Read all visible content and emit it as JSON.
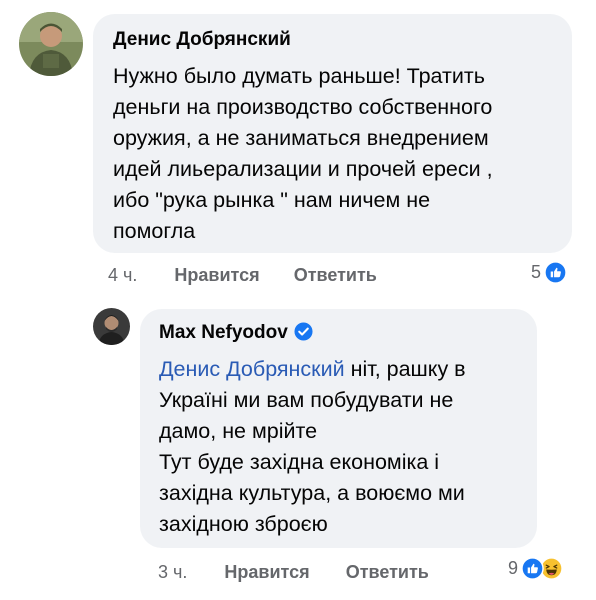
{
  "comments": [
    {
      "author": "Денис Добрянский",
      "lines": [
        "Нужно было думать раньше! Тратить",
        "деньги на производство собственного",
        "оружия,  а не заниматься внедрением",
        "идей лиьерализации и прочей ереси ,",
        "ибо \"рука рынка \" нам ничем не",
        "помогла"
      ],
      "time": "4 ч.",
      "like_label": "Нравится",
      "reply_label": "Ответить",
      "reaction_count": "5",
      "reaction_icons": [
        "like-icon"
      ]
    },
    {
      "author": "Max Nefyodov",
      "verified": true,
      "mention": "Денис Добрянский",
      "lines": [
        " ніт, рашку в",
        "Україні ми вам побудувати не",
        "дамо, не мрійте",
        "Тут буде західна економіка і",
        "західна культура, а воюємо ми",
        "західною зброєю"
      ],
      "time": "3 ч.",
      "like_label": "Нравится",
      "reply_label": "Ответить",
      "reaction_count": "9",
      "reaction_icons": [
        "like-icon",
        "haha-icon"
      ]
    }
  ],
  "colors": {
    "bubble": "#f0f2f5",
    "mention": "#2a5bb5",
    "like_blue": "#1877f2",
    "haha_yellow": "#f7c12f",
    "meta_gray": "#65676b"
  }
}
